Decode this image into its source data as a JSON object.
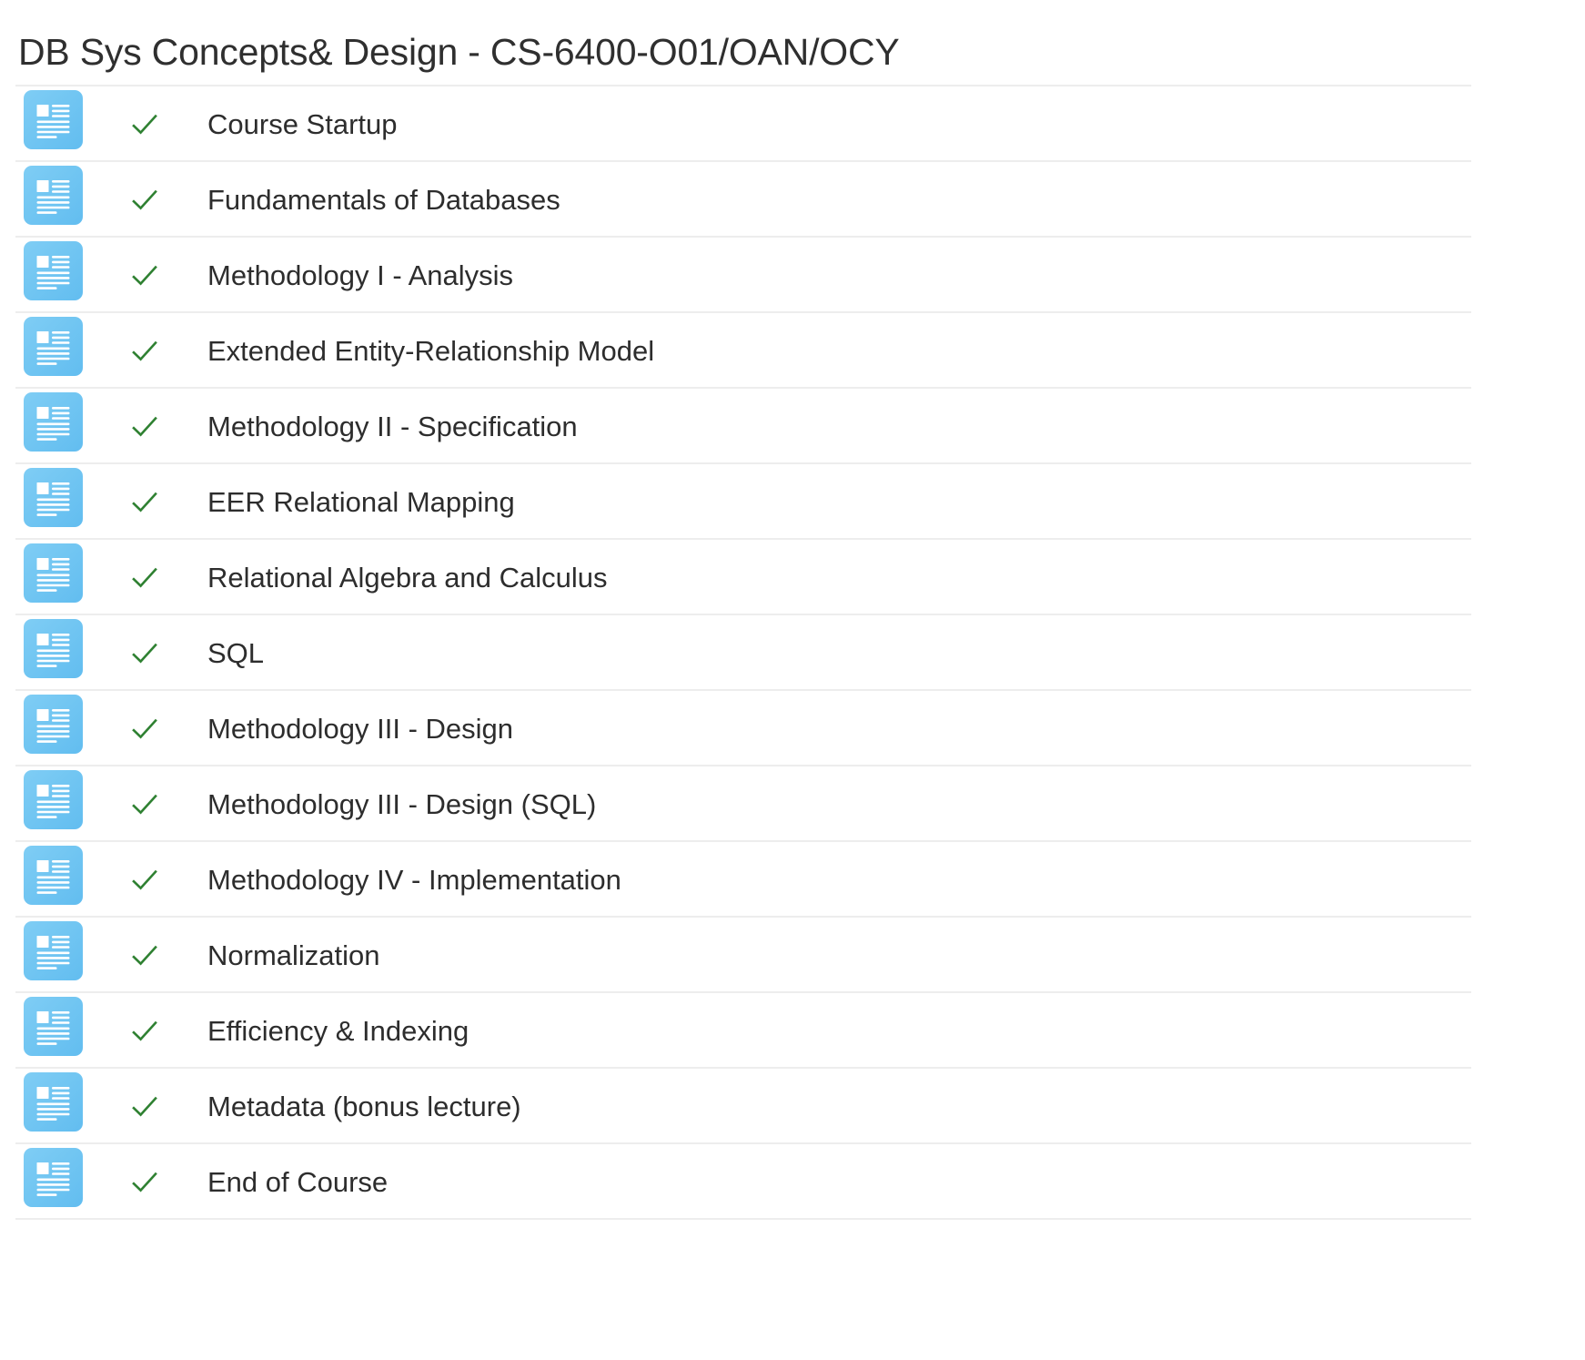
{
  "header": {
    "title": "DB Sys Concepts& Design - CS-6400-O01/OAN/OCY"
  },
  "colors": {
    "icon_blue_light": "#7fcdf5",
    "icon_blue_dark": "#62bdf0",
    "check_green": "#2f8132",
    "row_divider": "#ededed",
    "text": "#2d2d2d",
    "page_background": "#ffffff"
  },
  "icons": {
    "module_icon_name": "article-document-icon",
    "status_icon_name": "check-mark-icon"
  },
  "modules": [
    {
      "label": "Course Startup",
      "status": "complete"
    },
    {
      "label": "Fundamentals of Databases",
      "status": "complete"
    },
    {
      "label": "Methodology I - Analysis",
      "status": "complete"
    },
    {
      "label": "Extended Entity-Relationship Model",
      "status": "complete"
    },
    {
      "label": "Methodology II - Specification",
      "status": "complete"
    },
    {
      "label": "EER Relational Mapping",
      "status": "complete"
    },
    {
      "label": "Relational Algebra and Calculus",
      "status": "complete"
    },
    {
      "label": "SQL",
      "status": "complete"
    },
    {
      "label": "Methodology III - Design",
      "status": "complete"
    },
    {
      "label": "Methodology III - Design (SQL)",
      "status": "complete"
    },
    {
      "label": "Methodology IV - Implementation",
      "status": "complete"
    },
    {
      "label": "Normalization",
      "status": "complete"
    },
    {
      "label": "Efficiency & Indexing",
      "status": "complete"
    },
    {
      "label": "Metadata (bonus lecture)",
      "status": "complete"
    },
    {
      "label": "End of Course",
      "status": "complete"
    }
  ]
}
